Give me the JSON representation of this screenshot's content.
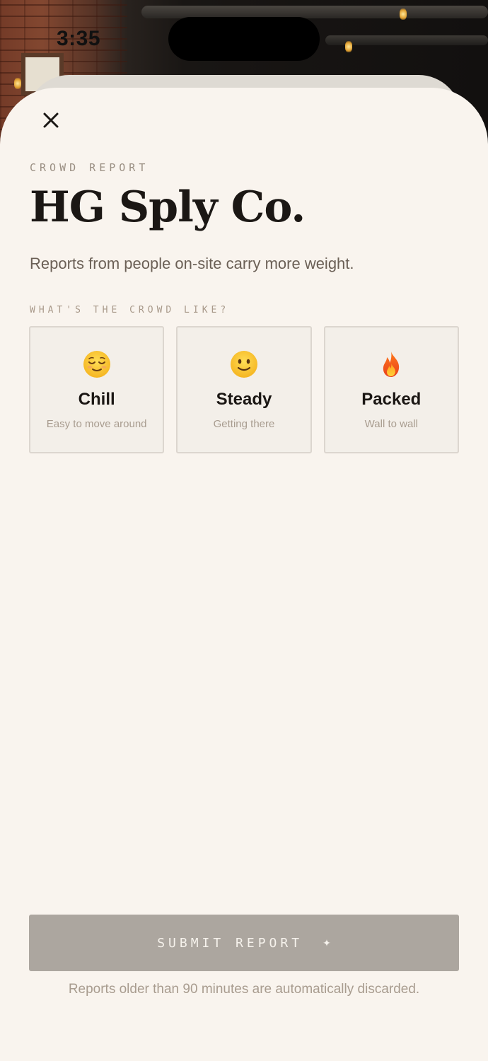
{
  "status_bar": {
    "time": "3:35"
  },
  "header": {
    "eyebrow": "CROWD REPORT",
    "title": "HG Sply Co.",
    "subtitle": "Reports from people on-site carry more weight."
  },
  "question": "WHAT'S THE CROWD LIKE?",
  "options": [
    {
      "icon": "relieved-face-icon",
      "label": "Chill",
      "description": "Easy to move around"
    },
    {
      "icon": "slightly-smiling-face-icon",
      "label": "Steady",
      "description": "Getting there"
    },
    {
      "icon": "fire-icon",
      "label": "Packed",
      "description": "Wall to wall"
    }
  ],
  "submit": {
    "label": "SUBMIT REPORT",
    "icon": "sparkle-icon"
  },
  "footnote": "Reports older than 90 minutes are automatically discarded.",
  "colors": {
    "sheet_background": "#f9f4ee",
    "submit_disabled": "#aca69f",
    "title_text": "#1b1714",
    "muted_text": "#a89c8f"
  }
}
